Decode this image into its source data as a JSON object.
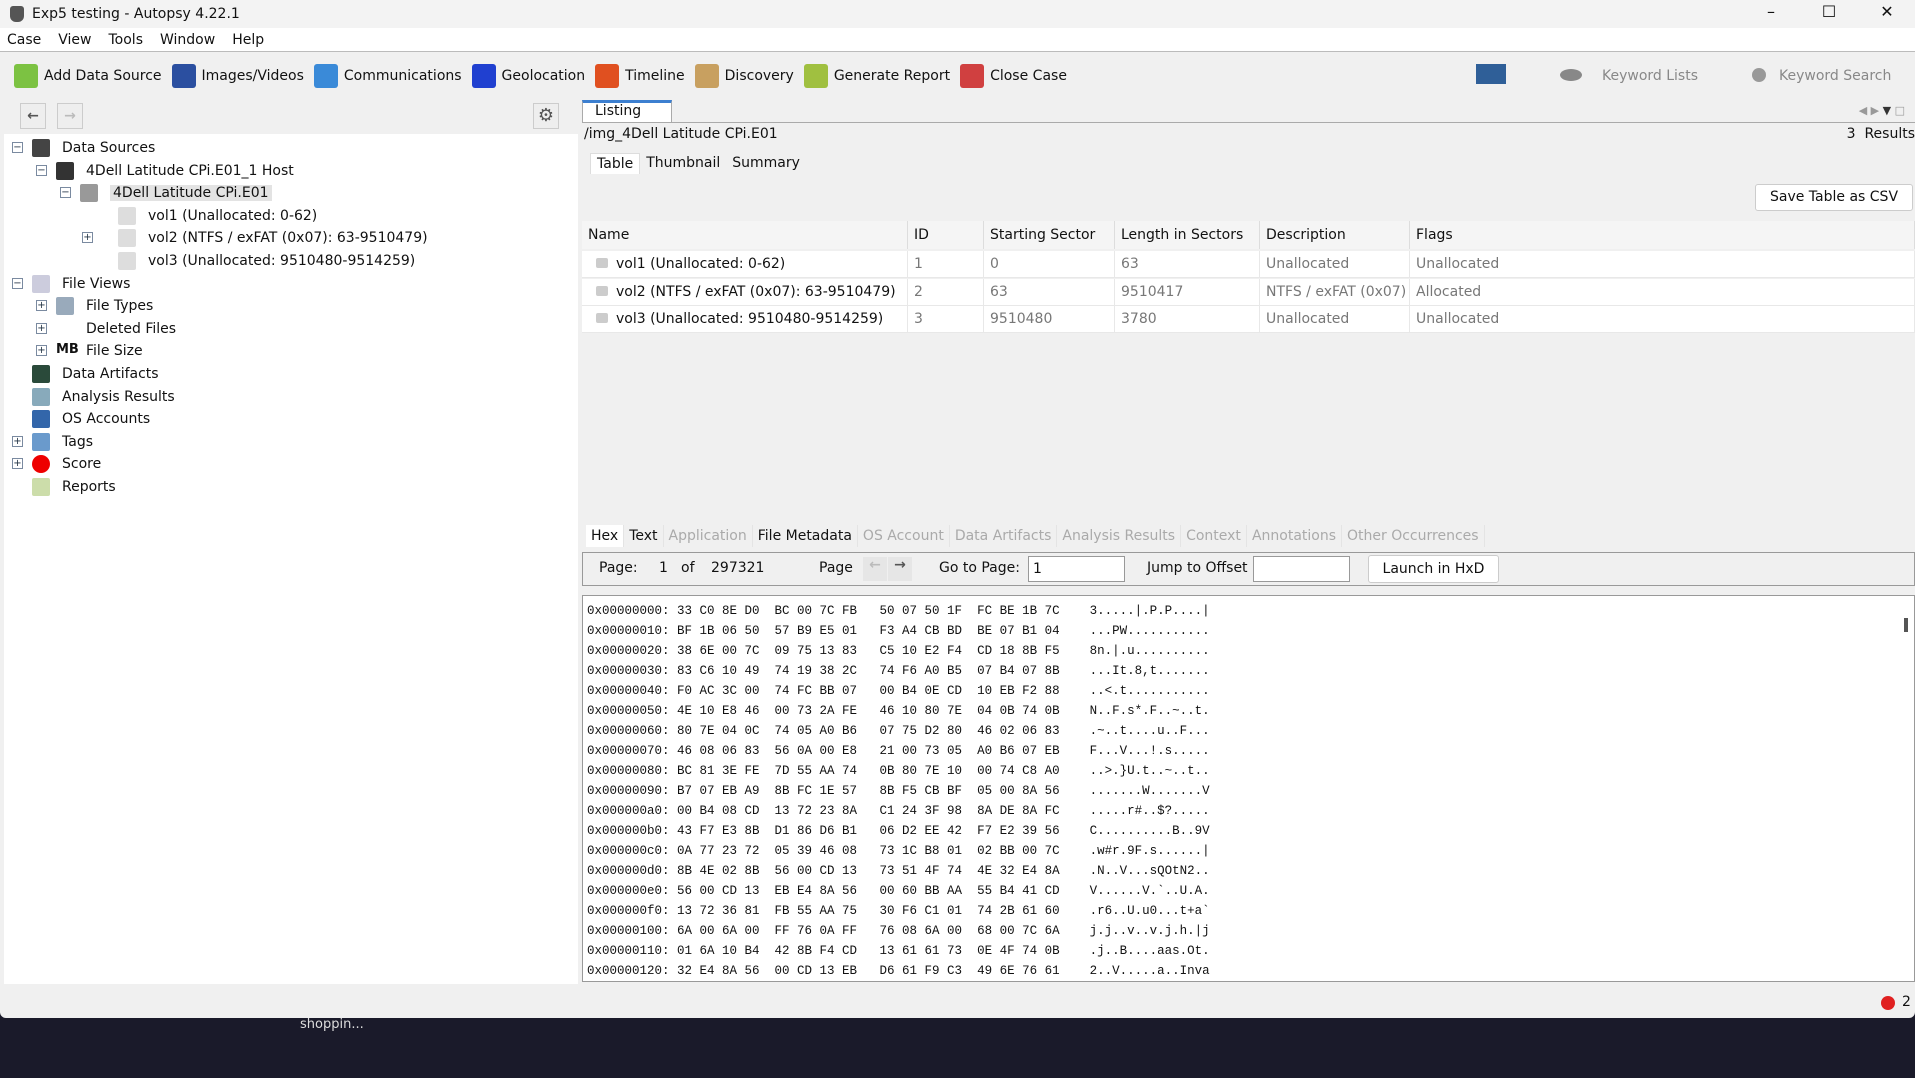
{
  "window": {
    "title": "Exp5 testing - Autopsy 4.22.1"
  },
  "menu": [
    "Case",
    "View",
    "Tools",
    "Window",
    "Help"
  ],
  "toolbar": {
    "items": [
      {
        "label": "Add Data Source",
        "icon": "plus-icon",
        "color": "#7cc242"
      },
      {
        "label": "Images/Videos",
        "icon": "images-icon",
        "color": "#2b4fa0"
      },
      {
        "label": "Communications",
        "icon": "communications-icon",
        "color": "#3a8ad8"
      },
      {
        "label": "Geolocation",
        "icon": "map-pin-icon",
        "color": "#2040d0"
      },
      {
        "label": "Timeline",
        "icon": "timeline-icon",
        "color": "#e05020"
      },
      {
        "label": "Discovery",
        "icon": "discovery-icon",
        "color": "#c8a060"
      },
      {
        "label": "Generate Report",
        "icon": "report-icon",
        "color": "#a0c040"
      },
      {
        "label": "Close Case",
        "icon": "close-case-icon",
        "color": "#d04040"
      }
    ],
    "keyword_lists": "Keyword Lists",
    "keyword_search": "Keyword Search"
  },
  "tree": [
    {
      "label": "Data Sources",
      "icon": "data-sources-icon",
      "expander": "-"
    },
    {
      "label": "4Dell Latitude CPi.E01_1 Host",
      "icon": "host-icon",
      "expander": "-"
    },
    {
      "label": "4Dell Latitude CPi.E01",
      "icon": "disk-image-icon",
      "expander": "-",
      "selected": true
    },
    {
      "label": "vol1 (Unallocated: 0-62)",
      "icon": "volume-icon"
    },
    {
      "label": "vol2 (NTFS / exFAT (0x07): 63-9510479)",
      "icon": "volume-icon",
      "expander": "+"
    },
    {
      "label": "vol3 (Unallocated: 9510480-9514259)",
      "icon": "volume-icon"
    },
    {
      "label": "File Views",
      "icon": "eye-icon",
      "expander": "-"
    },
    {
      "label": "File Types",
      "icon": "file-types-icon",
      "expander": "+"
    },
    {
      "label": "Deleted Files",
      "icon": "deleted-files-icon",
      "expander": "+"
    },
    {
      "label": "File Size",
      "icon": "file-size-icon",
      "icon_text": "MB",
      "expander": "+"
    },
    {
      "label": "Data Artifacts",
      "icon": "data-artifacts-icon"
    },
    {
      "label": "Analysis Results",
      "icon": "magnifier-icon"
    },
    {
      "label": "OS Accounts",
      "icon": "os-accounts-icon"
    },
    {
      "label": "Tags",
      "icon": "tags-icon",
      "expander": "+"
    },
    {
      "label": "Score",
      "icon": "score-icon",
      "expander": "+"
    },
    {
      "label": "Reports",
      "icon": "reports-icon"
    }
  ],
  "listing": {
    "tab": "Listing",
    "path": "/img_4Dell Latitude CPi.E01",
    "result_count": "3",
    "results_label": "Results",
    "subtabs": [
      "Table",
      "Thumbnail",
      "Summary"
    ],
    "save_csv": "Save Table as CSV",
    "columns": [
      "Name",
      "ID",
      "Starting Sector",
      "Length in Sectors",
      "Description",
      "Flags"
    ],
    "rows": [
      [
        "vol1 (Unallocated: 0-62)",
        "1",
        "0",
        "63",
        "Unallocated",
        "Unallocated"
      ],
      [
        "vol2 (NTFS / exFAT (0x07): 63-9510479)",
        "2",
        "63",
        "9510417",
        "NTFS / exFAT (0x07)",
        "Allocated"
      ],
      [
        "vol3 (Unallocated: 9510480-9514259)",
        "3",
        "9510480",
        "3780",
        "Unallocated",
        "Unallocated"
      ]
    ]
  },
  "content": {
    "tabs": [
      {
        "label": "Hex",
        "enabled": true,
        "active": true
      },
      {
        "label": "Text",
        "enabled": true
      },
      {
        "label": "Application",
        "enabled": false
      },
      {
        "label": "File Metadata",
        "enabled": true
      },
      {
        "label": "OS Account",
        "enabled": false
      },
      {
        "label": "Data Artifacts",
        "enabled": false
      },
      {
        "label": "Analysis Results",
        "enabled": false
      },
      {
        "label": "Context",
        "enabled": false
      },
      {
        "label": "Annotations",
        "enabled": false
      },
      {
        "label": "Other Occurrences",
        "enabled": false
      }
    ],
    "page_label": "Page:",
    "page": "1",
    "of_label": "of",
    "total_pages": "297321",
    "page_nav_label": "Page",
    "goto_label": "Go to Page:",
    "goto_value": "1",
    "jump_label": "Jump to Offset",
    "jump_value": "",
    "launch": "Launch in HxD",
    "hex_lines": [
      "0x00000000: 33 C0 8E D0  BC 00 7C FB   50 07 50 1F  FC BE 1B 7C    3.....|.P.P....|",
      "0x00000010: BF 1B 06 50  57 B9 E5 01   F3 A4 CB BD  BE 07 B1 04    ...PW...........",
      "0x00000020: 38 6E 00 7C  09 75 13 83   C5 10 E2 F4  CD 18 8B F5    8n.|.u..........",
      "0x00000030: 83 C6 10 49  74 19 38 2C   74 F6 A0 B5  07 B4 07 8B    ...It.8,t.......",
      "0x00000040: F0 AC 3C 00  74 FC BB 07   00 B4 0E CD  10 EB F2 88    ..<.t...........",
      "0x00000050: 4E 10 E8 46  00 73 2A FE   46 10 80 7E  04 0B 74 0B    N..F.s*.F..~..t.",
      "0x00000060: 80 7E 04 0C  74 05 A0 B6   07 75 D2 80  46 02 06 83    .~..t....u..F...",
      "0x00000070: 46 08 06 83  56 0A 00 E8   21 00 73 05  A0 B6 07 EB    F...V...!.s.....",
      "0x00000080: BC 81 3E FE  7D 55 AA 74   0B 80 7E 10  00 74 C8 A0    ..>.}U.t..~..t..",
      "0x00000090: B7 07 EB A9  8B FC 1E 57   8B F5 CB BF  05 00 8A 56    .......W.......V",
      "0x000000a0: 00 B4 08 CD  13 72 23 8A   C1 24 3F 98  8A DE 8A FC    .....r#..$?.....",
      "0x000000b0: 43 F7 E3 8B  D1 86 D6 B1   06 D2 EE 42  F7 E2 39 56    C..........B..9V",
      "0x000000c0: 0A 77 23 72  05 39 46 08   73 1C B8 01  02 BB 00 7C    .w#r.9F.s......|",
      "0x000000d0: 8B 4E 02 8B  56 00 CD 13   73 51 4F 74  4E 32 E4 8A    .N..V...sQOtN2..",
      "0x000000e0: 56 00 CD 13  EB E4 8A 56   00 60 BB AA  55 B4 41 CD    V......V.`..U.A.",
      "0x000000f0: 13 72 36 81  FB 55 AA 75   30 F6 C1 01  74 2B 61 60    .r6..U.u0...t+a`",
      "0x00000100: 6A 00 6A 00  FF 76 0A FF   76 08 6A 00  68 00 7C 6A    j.j..v..v.j.h.|j",
      "0x00000110: 01 6A 10 B4  42 8B F4 CD   13 61 61 73  0E 4F 74 0B    .j..B....aas.Ot.",
      "0x00000120: 32 E4 8A 56  00 CD 13 EB   D6 61 F9 C3  49 6E 76 61    2..V.....a..Inva"
    ]
  },
  "status": {
    "error_count": "2"
  },
  "desktop": {
    "taskbar_text": "shoppin..."
  }
}
